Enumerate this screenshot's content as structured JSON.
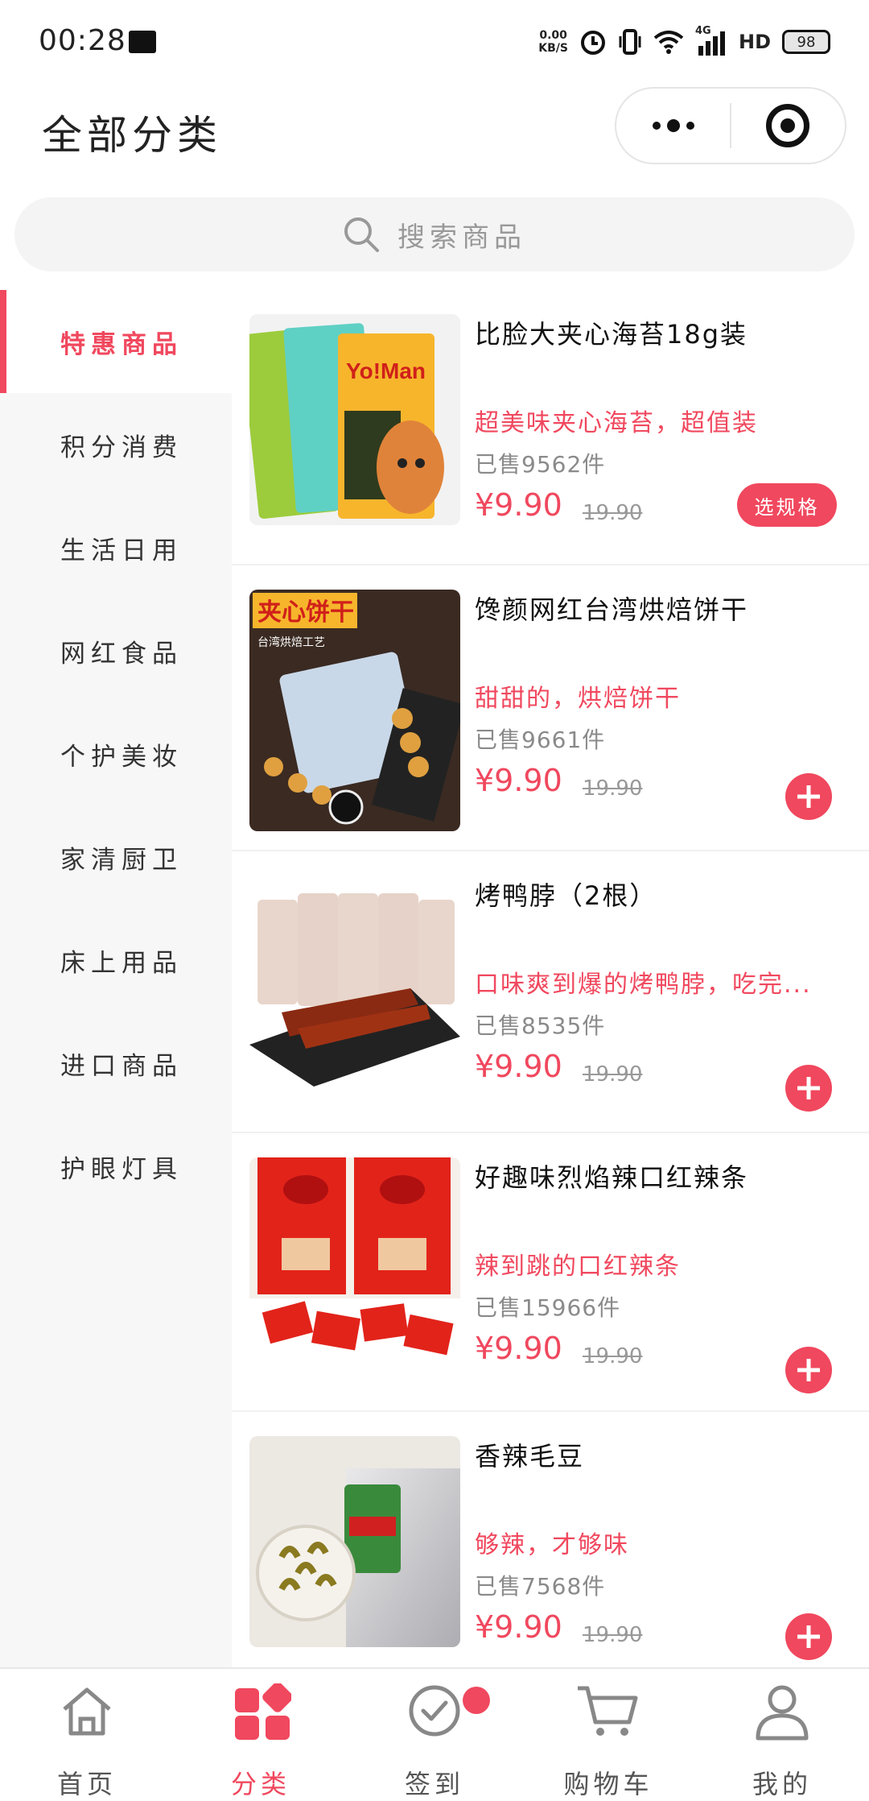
{
  "status_bar": {
    "time": "00:28",
    "net_speed_value": "0.00",
    "net_speed_unit": "KB/S",
    "signal": "4G",
    "hd": "HD",
    "battery": "98"
  },
  "header": {
    "title": "全部分类"
  },
  "search": {
    "placeholder": "搜索商品"
  },
  "sidebar": {
    "items": [
      {
        "label": "特惠商品",
        "active": true
      },
      {
        "label": "积分消费"
      },
      {
        "label": "生活日用"
      },
      {
        "label": "网红食品"
      },
      {
        "label": "个护美妆"
      },
      {
        "label": "家清厨卫"
      },
      {
        "label": "床上用品"
      },
      {
        "label": "进口商品"
      },
      {
        "label": "护眼灯具"
      }
    ]
  },
  "products": [
    {
      "name": "比脸大夹心海苔18g装",
      "desc": "超美味夹心海苔，超值装",
      "sold": "已售9562件",
      "price": "¥9.90",
      "original_price": "19.90",
      "action": "选规格"
    },
    {
      "name": "馋颜网红台湾烘焙饼干",
      "desc": "甜甜的，烘焙饼干",
      "sold": "已售9661件",
      "price": "¥9.90",
      "original_price": "19.90"
    },
    {
      "name": "烤鸭脖（2根）",
      "desc": "口味爽到爆的烤鸭脖，吃完...",
      "sold": "已售8535件",
      "price": "¥9.90",
      "original_price": "19.90"
    },
    {
      "name": "好趣味烈焰辣口红辣条",
      "desc": "辣到跳的口红辣条",
      "sold": "已售15966件",
      "price": "¥9.90",
      "original_price": "19.90"
    },
    {
      "name": "香辣毛豆",
      "desc": "够辣，才够味",
      "sold": "已售7568件",
      "price": "¥9.90",
      "original_price": "19.90"
    }
  ],
  "product_image_text": {
    "seaweed_brand": "Yo!Man",
    "cookie_title": "夹心饼干",
    "cookie_sub": "台湾烘焙工艺"
  },
  "tabbar": {
    "items": [
      {
        "label": "首页",
        "icon": "home-icon"
      },
      {
        "label": "分类",
        "icon": "category-icon",
        "active": true
      },
      {
        "label": "签到",
        "icon": "check-in-icon"
      },
      {
        "label": "购物车",
        "icon": "cart-icon"
      },
      {
        "label": "我的",
        "icon": "profile-icon"
      }
    ]
  },
  "colors": {
    "accent": "#f0485e",
    "sidebar_bg": "#f7f7f7",
    "search_bg": "#f4f4f4"
  }
}
